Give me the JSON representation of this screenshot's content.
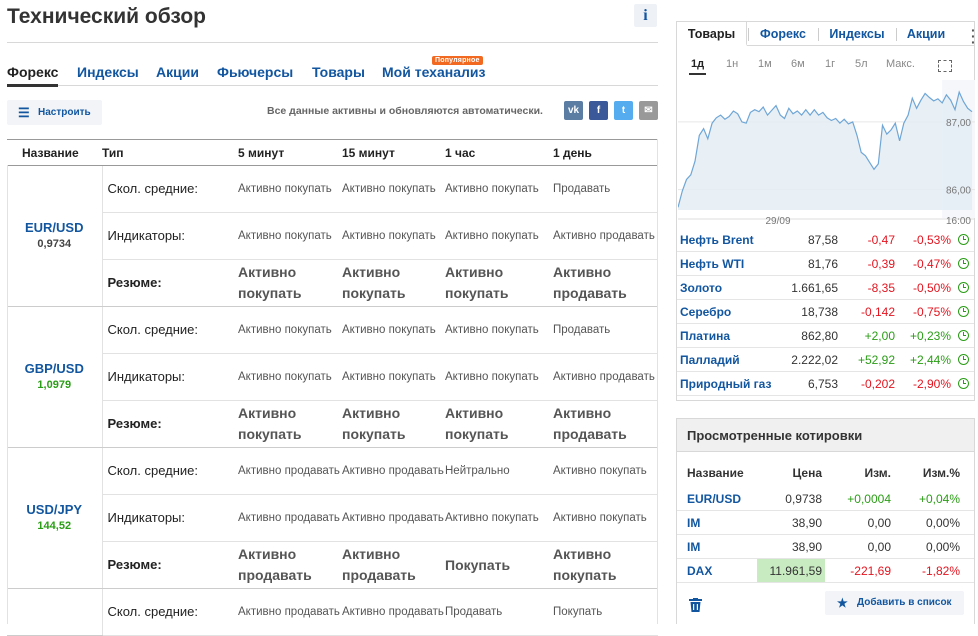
{
  "page": {
    "title": "Технический обзор",
    "info_icon": "i"
  },
  "tabs": [
    {
      "label": "Форекс",
      "active": true
    },
    {
      "label": "Индексы"
    },
    {
      "label": "Акции"
    },
    {
      "label": "Фьючерсы"
    },
    {
      "label": "Товары"
    },
    {
      "label": "Мой теханализ",
      "badge": "Популярное"
    }
  ],
  "toolbar": {
    "configure_label": "Настроить",
    "configure_icon": "sliders-icon",
    "auto_text": "Все данные активны и обновляются автоматически.",
    "social": [
      {
        "name": "vk-icon",
        "glyph": "vk",
        "color": "#5b7ca3"
      },
      {
        "name": "facebook-icon",
        "glyph": "f",
        "color": "#3b5998"
      },
      {
        "name": "twitter-icon",
        "glyph": "t",
        "color": "#55acee"
      },
      {
        "name": "email-icon",
        "glyph": "✉",
        "color": "#999999"
      }
    ]
  },
  "table": {
    "headers": [
      "Название",
      "Тип",
      "5 минут",
      "15 минут",
      "1 час",
      "1 день"
    ],
    "groups": [
      {
        "pair": "EUR/USD",
        "value": "0,9734",
        "value_color": "neutral",
        "rows": [
          {
            "type": "Скол. средние:",
            "values": [
              "Активно покупать",
              "Активно покупать",
              "Активно покупать",
              "Продавать"
            ]
          },
          {
            "type": "Индикаторы:",
            "values": [
              "Активно покупать",
              "Активно покупать",
              "Активно покупать",
              "Активно продавать"
            ]
          },
          {
            "type": "Резюме:",
            "summary": true,
            "values": [
              "Активно покупать",
              "Активно покупать",
              "Активно покупать",
              "Активно продавать"
            ],
            "colors": [
              "buy",
              "buy",
              "buy",
              "sell"
            ]
          }
        ]
      },
      {
        "pair": "GBP/USD",
        "value": "1,0979",
        "value_color": "green",
        "rows": [
          {
            "type": "Скол. средние:",
            "values": [
              "Активно покупать",
              "Активно покупать",
              "Активно покупать",
              "Продавать"
            ]
          },
          {
            "type": "Индикаторы:",
            "values": [
              "Активно покупать",
              "Активно покупать",
              "Активно покупать",
              "Активно продавать"
            ]
          },
          {
            "type": "Резюме:",
            "summary": true,
            "values": [
              "Активно покупать",
              "Активно покупать",
              "Активно покупать",
              "Активно продавать"
            ],
            "colors": [
              "buy",
              "buy",
              "buy",
              "sell"
            ]
          }
        ]
      },
      {
        "pair": "USD/JPY",
        "value": "144,52",
        "value_color": "green",
        "rows": [
          {
            "type": "Скол. средние:",
            "values": [
              "Активно продавать",
              "Активно продавать",
              "Нейтрально",
              "Активно покупать"
            ]
          },
          {
            "type": "Индикаторы:",
            "values": [
              "Активно продавать",
              "Активно продавать",
              "Активно покупать",
              "Активно покупать"
            ]
          },
          {
            "type": "Резюме:",
            "summary": true,
            "values": [
              "Активно продавать",
              "Активно продавать",
              "Покупать",
              "Активно покупать"
            ],
            "colors": [
              "sell",
              "sell",
              "buy",
              "buy"
            ]
          }
        ]
      },
      {
        "pair": "",
        "value": "",
        "value_color": "neutral",
        "rows": [
          {
            "type": "Скол. средние:",
            "values": [
              "Активно продавать",
              "Активно продавать",
              "Продавать",
              "Покупать"
            ]
          }
        ]
      }
    ]
  },
  "widget": {
    "tabs": [
      "Товары",
      "Форекс",
      "Индексы",
      "Акции"
    ],
    "active_tab": 0,
    "periods": [
      "1д",
      "1н",
      "1м",
      "6м",
      "1г",
      "5л",
      "Макс."
    ],
    "active_period": 0,
    "chart_data": {
      "type": "area",
      "x_ticks": [
        "29/09",
        "16:00"
      ],
      "y_ticks": [
        "87,00",
        "86,00"
      ],
      "ylim": [
        85.7,
        87.5
      ],
      "color": "#6fa6d6",
      "fill": "#e4edf5",
      "values": [
        85.74,
        85.98,
        86.15,
        86.22,
        86.42,
        86.8,
        86.9,
        86.75,
        86.98,
        87.06,
        87.1,
        87.04,
        87.08,
        87.16,
        87.12,
        87.0,
        86.98,
        87.14,
        87.18,
        87.15,
        87.22,
        87.1,
        87.17,
        87.24,
        87.1,
        87.05,
        87.2,
        87.12,
        87.16,
        87.1,
        87.18,
        87.1,
        87.18,
        87.1,
        87.14,
        87.06,
        87.02,
        87.05,
        86.98,
        87.04,
        86.97,
        87.0,
        86.8,
        86.55,
        86.5,
        86.4,
        86.3,
        86.38,
        86.95,
        86.82,
        86.88,
        86.98,
        86.72,
        86.98,
        87.1,
        87.35,
        87.2,
        87.32,
        87.42,
        87.36,
        87.31,
        87.34,
        87.28,
        87.4,
        87.32,
        87.18,
        87.44,
        87.3,
        87.2,
        87.15
      ],
      "session_start_index": 62
    },
    "quotes": [
      {
        "name": "Нефть Brent",
        "price": "87,58",
        "change": "-0,47",
        "pct": "-0,53%",
        "dir": "neg"
      },
      {
        "name": "Нефть WTI",
        "price": "81,76",
        "change": "-0,39",
        "pct": "-0,47%",
        "dir": "neg"
      },
      {
        "name": "Золото",
        "price": "1.661,65",
        "change": "-8,35",
        "pct": "-0,50%",
        "dir": "neg"
      },
      {
        "name": "Серебро",
        "price": "18,738",
        "change": "-0,142",
        "pct": "-0,75%",
        "dir": "neg"
      },
      {
        "name": "Платина",
        "price": "862,80",
        "change": "+2,00",
        "pct": "+0,23%",
        "dir": "pos"
      },
      {
        "name": "Палладий",
        "price": "2.222,02",
        "change": "+52,92",
        "pct": "+2,44%",
        "dir": "pos"
      },
      {
        "name": "Природный газ",
        "price": "6,753",
        "change": "-0,202",
        "pct": "-2,90%",
        "dir": "neg"
      }
    ]
  },
  "viewed": {
    "title": "Просмотренные котировки",
    "headers": [
      "Название",
      "Цена",
      "Изм.",
      "Изм.%"
    ],
    "rows": [
      {
        "name": "EUR/USD",
        "price": "0,9738",
        "change": "+0,0004",
        "pct": "+0,04%",
        "dir": "pos"
      },
      {
        "name": "IM",
        "price": "38,90",
        "change": "0,00",
        "pct": "0,00%",
        "dir": "zero"
      },
      {
        "name": "IM",
        "price": "38,90",
        "change": "0,00",
        "pct": "0,00%",
        "dir": "zero"
      },
      {
        "name": "DAX",
        "price": "11.961,59",
        "change": "-221,69",
        "pct": "-1,82%",
        "dir": "neg",
        "highlight": true
      }
    ],
    "add_label": "Добавить в список",
    "trash_icon": "trash-icon",
    "star_icon": "star-icon"
  }
}
